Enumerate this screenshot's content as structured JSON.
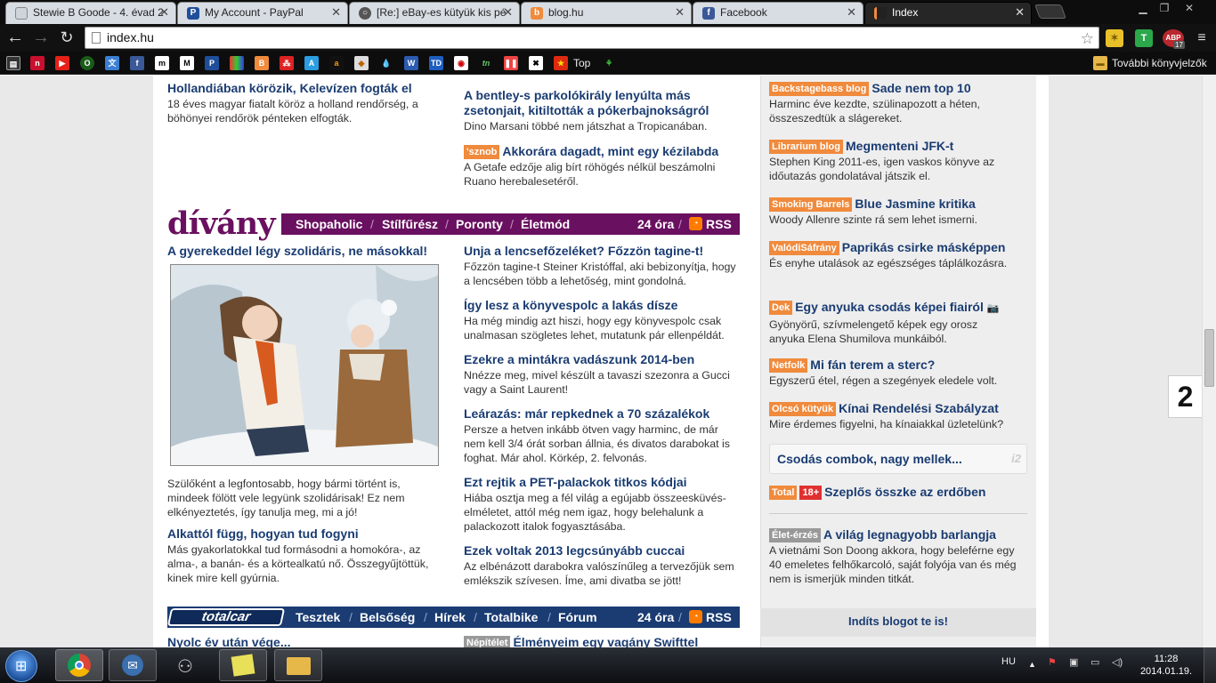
{
  "browser": {
    "tabs": [
      {
        "title": "Stewie B Goode - 4. évad 2",
        "icon": "page-icon",
        "color": "#cfd4da"
      },
      {
        "title": "My Account - PayPal",
        "icon": "paypal-icon",
        "color": "#1f4f9a"
      },
      {
        "title": "[Re:] eBay-es kütyük kis pé",
        "icon": "forum-icon",
        "color": "#555"
      },
      {
        "title": "blog.hu",
        "icon": "blog-icon",
        "color": "#f08a3c"
      },
      {
        "title": "Facebook",
        "icon": "facebook-icon",
        "color": "#3b5998"
      },
      {
        "title": "Index",
        "icon": "index-icon",
        "color": "#222"
      }
    ],
    "address": "index.hu",
    "ext_abp_label": "ABP",
    "ext_abp_count": "17",
    "bookmarks_other": "További könyvjelzők",
    "bookmark_top": "Top"
  },
  "left_top": {
    "title": "Hollandiában körözik, Kelevízen fogták el",
    "text": "18 éves magyar fiatalt köröz a holland rendőrség, a böhönyei rendőrök pénteken elfogták."
  },
  "mid_top": [
    {
      "title": "A bentley-s parkolókirály lenyúlta más zsetonjait, kitiltották a pókerbajnokságról",
      "text": "Dino Marsani többé nem játszhat a Tropicanában."
    },
    {
      "tag": "'sznob",
      "title": "Akkorára dagadt, mint egy kézilabda",
      "text": "A Getafe edzője alig bírt röhögés nélkül beszámolni Ruano herebalesetéről."
    }
  ],
  "divany": {
    "logo": "dívány",
    "nav": [
      "Shopaholic",
      "Stílfűrész",
      "Poronty",
      "Életmód"
    ],
    "hours": "24 óra",
    "rss": "RSS"
  },
  "main_story": {
    "title": "A gyerekeddel légy szolidáris, ne másokkal!",
    "text": "Szülőként a legfontosabb, hogy bármi történt is, mindeek fölött vele legyünk szolidárisak! Ez nem elkényeztetés, így tanulja meg, mi a jó!"
  },
  "left_second": {
    "title": "Alkattól függ, hogyan tud fogyni",
    "text": "Más gyakorlatokkal tud formásodni a homokóra-, az alma-, a banán- és a körtealkatú nő. Összegyűjtöttük, kinek mire kell gyúrnia."
  },
  "divany_right": [
    {
      "title": "Unja a lencsefőzeléket? Főzzön tagine-t!",
      "text": "Főzzön tagine-t Steiner Kristóffal, aki bebizonyítja, hogy a lencsében több a lehetőség, mint gondolná."
    },
    {
      "title": "Így lesz a könyvespolc a lakás dísze",
      "text": "Ha még mindig azt hiszi, hogy egy könyvespolc csak unalmasan szögletes lehet, mutatunk pár ellenpéldát."
    },
    {
      "title": "Ezekre a mintákra vadászunk 2014-ben",
      "text": "Nnézze meg, mivel készült a tavaszi szezonra a Gucci vagy a Saint Laurent!"
    },
    {
      "title": "Leárazás: már repkednek a 70 százalékok",
      "text": "Persze a hetven inkább ötven vagy harminc, de már nem kell 3/4 órát sorban állnia, és divatos darabokat is foghat. Már ahol. Körkép, 2. felvonás."
    },
    {
      "title": "Ezt rejtik a PET-palackok titkos kódjai",
      "text": "Hiába osztja meg a fél világ a egújabb összeesküvés-elméletet, attól még nem igaz, hogy belehalunk a palackozott italok fogyasztásába."
    },
    {
      "title": "Ezek voltak 2013 legcsúnyább cuccai",
      "text": "Az elbénázott darabokra valószínűleg a tervezőjük sem emlékszik szívesen. Íme, ami divatba se jött!"
    }
  ],
  "totalcar": {
    "logo": "totalcar",
    "nav": [
      "Tesztek",
      "Belsőség",
      "Hírek",
      "Totalbike",
      "Fórum"
    ],
    "hours": "24 óra",
    "rss": "RSS",
    "left_title": "Nyolc év után vége...",
    "right_tag": "Népítélet",
    "right_title": "Élményeim egy vagány Swifttel"
  },
  "blogs": [
    {
      "tag": "Backstagebass blog",
      "title": "Sade nem top 10",
      "text": "Harminc éve kezdte, szülinapozott a héten, összeszedtük a slágereket."
    },
    {
      "tag": "Librarium blog",
      "title": "Megmenteni JFK-t",
      "text": "Stephen King 2011-es, igen vaskos könyve az időutazás gondolatával játszik el."
    },
    {
      "tag": "Smoking Barrels",
      "title": "Blue Jasmine kritika",
      "text": "Woody Allenre szinte rá sem lehet ismerni."
    },
    {
      "tag": "ValódiSáfrány",
      "title": "Paprikás csirke másképpen",
      "text": "És enyhe utalások az egészséges táplálkozásra."
    },
    {
      "tag": "Dek",
      "title": "Egy anyuka csodás képei fiairól",
      "text": "Gyönyörű, szívmelengető képek egy orosz anyuka Elena Shumilova munkáiból."
    },
    {
      "tag": "Netfolk",
      "title": "Mi fán terem a sterc?",
      "text": "Egyszerű étel, régen a szegények eledele volt."
    },
    {
      "tag": "Olcsó kütyük",
      "title": "Kínai Rendelési Szabályzat",
      "text": "Mire érdemes figyelni, ha kínaiakkal üzletelünk?"
    }
  ],
  "combo": {
    "title": "Csodás combok, nagy mellek...",
    "badge": "i2"
  },
  "total_item": {
    "tag": "Total",
    "tag2": "18+",
    "title": "Szeplős összke az erdőben"
  },
  "elet": {
    "tag": "Élet-érzés",
    "title": "A világ legnagyobb barlangja",
    "text": "A vietnámi Son Doong akkora, hogy beleférne egy 40 emeletes felhőkarcoló, saját folyója van és még nem is ismerjük minden titkát."
  },
  "indits": "Indíts blogot te is!",
  "ribbon": "2",
  "taskbar": {
    "lang": "HU",
    "time": "11:28",
    "date": "2014.01.19."
  }
}
